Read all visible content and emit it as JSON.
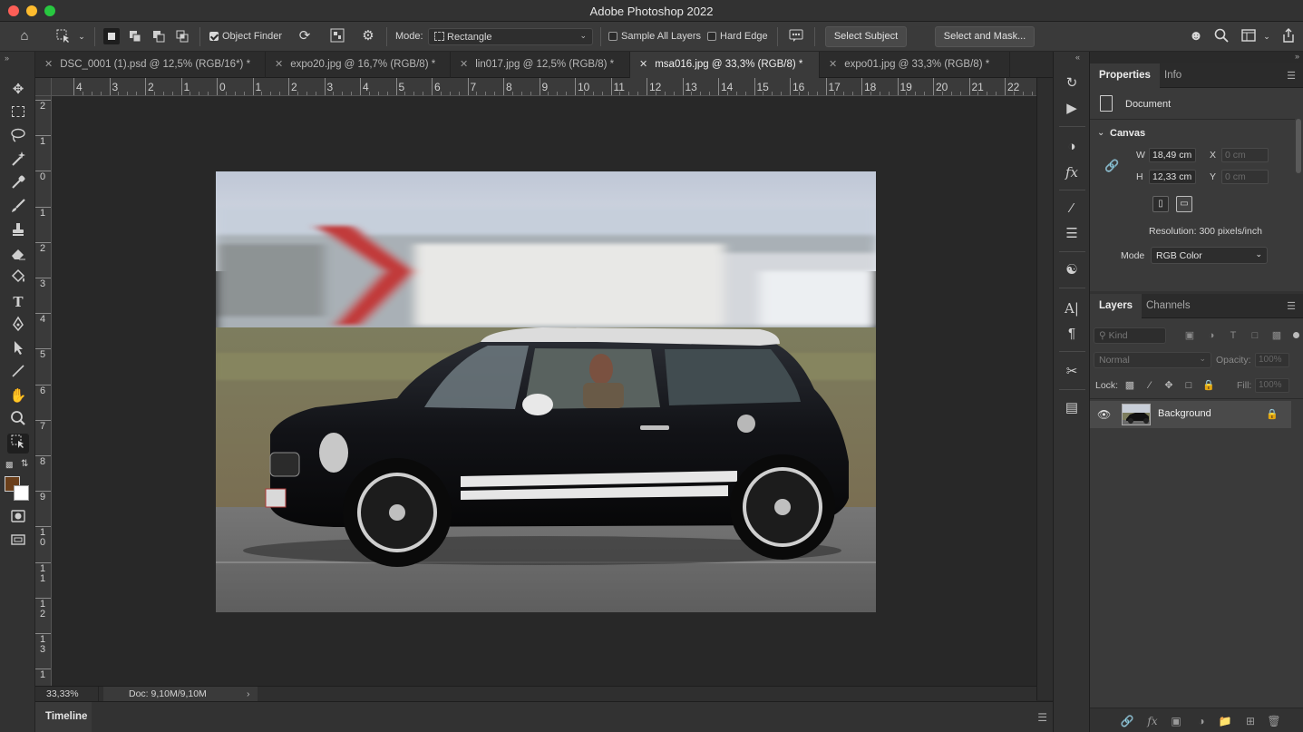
{
  "window": {
    "title": "Adobe Photoshop 2022"
  },
  "options_bar": {
    "object_finder_label": "Object Finder",
    "mode_label": "Mode:",
    "mode_value": "Rectangle",
    "sample_all_layers_label": "Sample All Layers",
    "hard_edge_label": "Hard Edge",
    "select_subject_label": "Select Subject",
    "select_and_mask_label": "Select and Mask..."
  },
  "tabs": [
    {
      "label": "DSC_0001 (1).psd @ 12,5% (RGB/16*) *",
      "active": false
    },
    {
      "label": "expo20.jpg @ 16,7% (RGB/8) *",
      "active": false
    },
    {
      "label": "lin017.jpg @ 12,5% (RGB/8) *",
      "active": false
    },
    {
      "label": "msa016.jpg @ 33,3% (RGB/8) *",
      "active": true
    },
    {
      "label": "expo01.jpg @ 33,3% (RGB/8) *",
      "active": false
    }
  ],
  "ruler": {
    "horizontal": [
      "4",
      "3",
      "2",
      "1",
      "0",
      "1",
      "2",
      "3",
      "4",
      "5",
      "6",
      "7",
      "8",
      "9",
      "10",
      "11",
      "12",
      "13",
      "14",
      "15",
      "16",
      "17",
      "18",
      "19",
      "20",
      "21",
      "22"
    ],
    "vertical": [
      "2",
      "1",
      "0",
      "1",
      "2",
      "3",
      "4",
      "5",
      "6",
      "7",
      "8",
      "9",
      "10",
      "11",
      "12",
      "13",
      "1"
    ]
  },
  "status_bar": {
    "zoom": "33,33%",
    "doc_info": "Doc: 9,10M/9,10M"
  },
  "timeline": {
    "label": "Timeline"
  },
  "properties": {
    "tabs": [
      "Properties",
      "Info"
    ],
    "section": "Document",
    "canvas_heading": "Canvas",
    "width_label": "W",
    "width_value": "18,49 cm",
    "height_label": "H",
    "height_value": "12,33 cm",
    "x_label": "X",
    "x_value": "0 cm",
    "y_label": "Y",
    "y_value": "0 cm",
    "resolution": "Resolution: 300 pixels/inch",
    "mode_label": "Mode",
    "mode_value": "RGB Color"
  },
  "layers": {
    "tabs": [
      "Layers",
      "Channels"
    ],
    "filter_placeholder": "Kind",
    "blend_mode": "Normal",
    "opacity_label": "Opacity:",
    "opacity_value": "100%",
    "lock_label": "Lock:",
    "fill_label": "Fill:",
    "fill_value": "100%",
    "items": [
      {
        "name": "Background",
        "visible": true,
        "locked": true
      }
    ]
  },
  "colors": {
    "foreground": "#6b3f1a",
    "background": "#ffffff",
    "accent_close": "#fe5f57",
    "accent_minimize": "#febc2e",
    "accent_zoom": "#28c840"
  },
  "icons": {
    "toolbar": [
      "move-icon",
      "marquee-icon",
      "lasso-icon",
      "magic-wand-icon",
      "eyedropper-icon",
      "brush-icon",
      "stamp-icon",
      "eraser-icon",
      "paint-bucket-icon",
      "type-icon",
      "pen-icon",
      "path-select-icon",
      "line-icon",
      "hand-icon",
      "zoom-icon",
      "object-select-icon"
    ]
  }
}
